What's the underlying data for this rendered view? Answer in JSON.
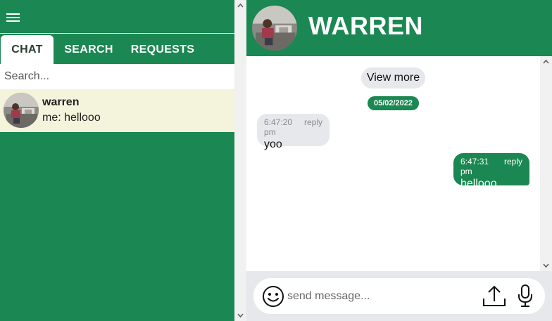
{
  "sidebar": {
    "tabs": [
      {
        "label": "CHAT",
        "active": true
      },
      {
        "label": "SEARCH",
        "active": false
      },
      {
        "label": "REQUESTS",
        "active": false
      }
    ],
    "search": {
      "placeholder": "Search..."
    },
    "contacts": [
      {
        "name": "warren",
        "last_message": "me: hellooo",
        "avatar": "photo-avatar"
      }
    ]
  },
  "header": {
    "name": "WARREN",
    "avatar": "photo-avatar"
  },
  "chat": {
    "view_more_label": "View more",
    "date": "05/02/2022",
    "messages": [
      {
        "direction": "incoming",
        "time": "6:47:20 pm",
        "reply_label": "reply",
        "text": "yoo"
      },
      {
        "direction": "outgoing",
        "time": "6:47:31 pm",
        "reply_label": "reply",
        "text": "hellooo"
      }
    ]
  },
  "composer": {
    "placeholder": "send message...",
    "icons": [
      "emoji-icon",
      "upload-icon",
      "microphone-icon"
    ]
  },
  "colors": {
    "brand_green": "#1b8752",
    "active_contact_bg": "#f4f3dc",
    "bubble_incoming": "#e6e8ec",
    "bubble_outgoing": "#1b8752"
  }
}
